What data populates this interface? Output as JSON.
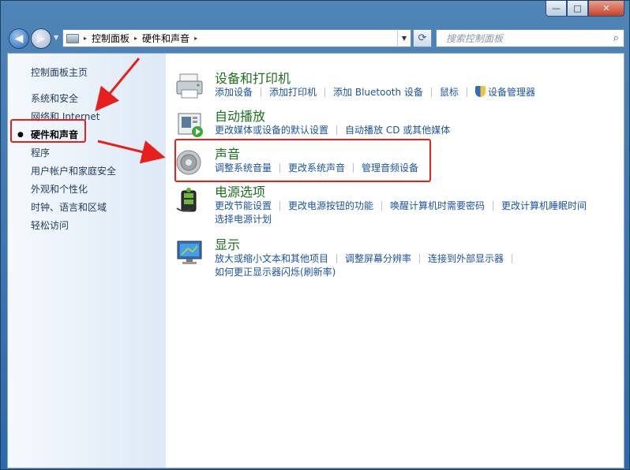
{
  "window": {
    "min_label": "—",
    "max_label": "□",
    "close_label": "✕"
  },
  "address": {
    "crumbs": [
      "控制面板",
      "硬件和声音"
    ],
    "sep": "▸"
  },
  "search": {
    "placeholder": "搜索控制面板"
  },
  "sidebar": {
    "items": [
      {
        "label": "控制面板主页",
        "active": false
      },
      {
        "label": "系统和安全",
        "active": false
      },
      {
        "label": "网络和 Internet",
        "active": false
      },
      {
        "label": "硬件和声音",
        "active": true
      },
      {
        "label": "程序",
        "active": false
      },
      {
        "label": "用户帐户和家庭安全",
        "active": false
      },
      {
        "label": "外观和个性化",
        "active": false
      },
      {
        "label": "时钟、语言和区域",
        "active": false
      },
      {
        "label": "轻松访问",
        "active": false
      }
    ],
    "bullet": "●"
  },
  "categories": [
    {
      "title": "设备和打印机",
      "icon": "printer-icon",
      "links": [
        "添加设备",
        "添加打印机",
        "添加 Bluetooth 设备",
        "鼠标",
        "设备管理器"
      ],
      "links2": ""
    },
    {
      "title": "自动播放",
      "icon": "autoplay-icon",
      "links": [
        "更改媒体或设备的默认设置",
        "自动播放 CD 或其他媒体"
      ],
      "links2": ""
    },
    {
      "title": "声音",
      "icon": "speaker-icon",
      "links": [
        "调整系统音量",
        "更改系统声音",
        "管理音频设备"
      ],
      "links2": ""
    },
    {
      "title": "电源选项",
      "icon": "power-icon",
      "links": [
        "更改节能设置",
        "更改电源按钮的功能",
        "唤醒计算机时需要密码",
        "更改计算机睡眠时间"
      ],
      "links2": "选择电源计划"
    },
    {
      "title": "显示",
      "icon": "display-icon",
      "links": [
        "放大或缩小文本和其他项目",
        "调整屏幕分辨率",
        "连接到外部显示器"
      ],
      "links2": "如何更正显示器闪烁(刷新率)"
    }
  ],
  "colors": {
    "category_title": "#1e6e1e",
    "link": "#1b53a3",
    "highlight_box": "#e8201c"
  }
}
